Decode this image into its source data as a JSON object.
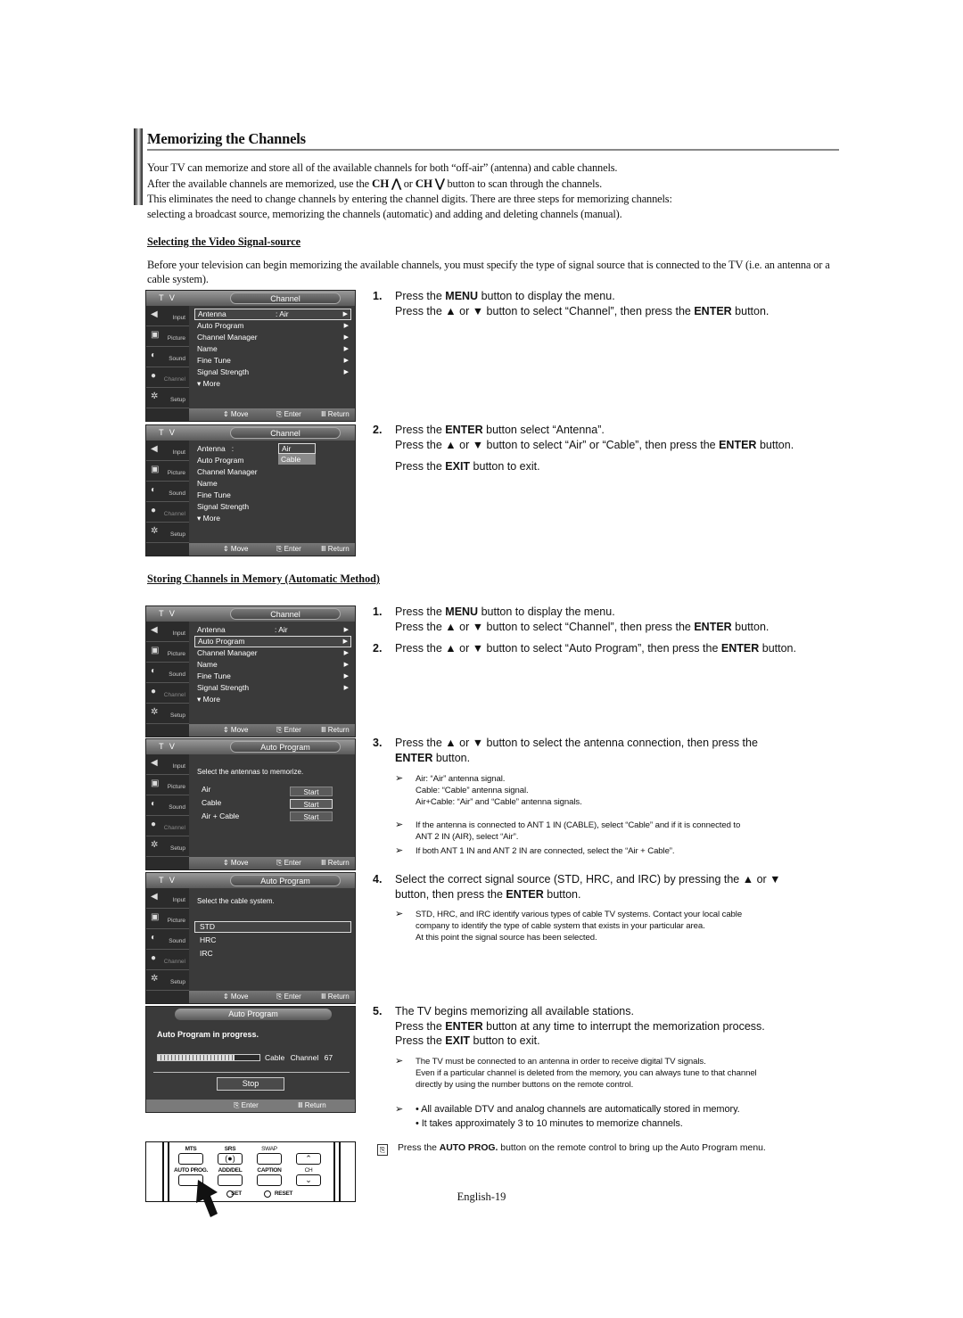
{
  "page": {
    "title": "Memorizing the Channels",
    "intro": {
      "line1": "Your TV can memorize and store all of the available channels for both “off-air” (antenna) and cable channels.",
      "line2_pre": "After the available channels are memorized, use the ",
      "ch_up": "CH ⋀",
      "line2_or": " or ",
      "ch_down": "CH ⋁",
      "line2_post": " button to scan through the channels.",
      "line3": "This eliminates the need to change channels by entering the channel digits. There are three steps for memorizing channels:",
      "line4": "selecting a broadcast source, memorizing the channels (automatic) and adding and deleting channels (manual)."
    },
    "footer": "English-19"
  },
  "section1": {
    "heading": "Selecting the Video Signal-source",
    "para": "Before your television can begin memorizing the available channels, you must specify the type of signal source that is connected to the TV (i.e. an antenna or a cable system).",
    "steps": [
      {
        "num": "1.",
        "l1_pre": "Press the ",
        "l1_b": "MENU",
        "l1_post": " button to display the menu.",
        "l2_pre": "Press the ▲ or ▼ button to select “Channel”, then press the ",
        "l2_b": "ENTER",
        "l2_post": " button."
      },
      {
        "num": "2.",
        "l1_pre": "Press the ",
        "l1_b": "ENTER",
        "l1_post": " button select “Antenna”.",
        "l2_pre": "Press the ▲ or ▼ button to select “Air” or “Cable”, then press the ",
        "l2_b": "ENTER",
        "l2_post": " button.",
        "l3_pre": "Press the ",
        "l3_b": "EXIT",
        "l3_post": " button to exit."
      }
    ]
  },
  "section2": {
    "heading": "Storing Channels in Memory (Automatic Method)",
    "steps": [
      {
        "num": "1.",
        "l1_pre": "Press the ",
        "l1_b": "MENU",
        "l1_post": " button to display the menu.",
        "l2_pre": "Press the ▲ or ▼ button to select “Channel”, then press the ",
        "l2_b": "ENTER",
        "l2_post": " button."
      },
      {
        "num": "2.",
        "l1_pre": "Press the ▲ or ▼ button to select “Auto Program”, then press the ",
        "l1_b": "ENTER",
        "l1_post": " button."
      },
      {
        "num": "3.",
        "l1_pre": "Press the ▲ or ▼ button to select the antenna connection, then press the",
        "l2_b": "ENTER",
        "l2_post": " button."
      },
      {
        "num": "4.",
        "l1_pre": "Select the correct signal source (STD, HRC, and IRC) by pressing the ▲ or ▼",
        "l2_pre": "button, then press the ",
        "l2_b": "ENTER",
        "l2_post": " button."
      },
      {
        "num": "5.",
        "l1_pre": "The TV begins memorizing all available stations.",
        "l2_pre": "Press the ",
        "l2_b": "ENTER",
        "l2_post": " button at any time to interrupt the memorization process.",
        "l3_pre": "Press the ",
        "l3_b": "EXIT",
        "l3_post": " button to exit."
      }
    ],
    "notes": {
      "step3_a": [
        "Air: “Air” antenna signal.",
        "Cable: “Cable” antenna signal.",
        "Air+Cable: “Air” and “Cable” antenna signals."
      ],
      "step3_b": [
        "If the antenna is connected to ANT 1 IN (CABLE), select “Cable” and if it is connected to",
        "ANT 2 IN (AIR), select “Air”."
      ],
      "step3_c": [
        "If both ANT 1 IN and ANT 2 IN are connected, select the “Air + Cable”."
      ],
      "step4": [
        "STD, HRC, and IRC identify various types of cable TV systems. Contact your local cable",
        "company to identify the type of cable system that exists in your particular area.",
        "At this point the signal source has been selected."
      ],
      "step5_a": [
        "The TV must be connected to an antenna in order to receive digital TV signals.",
        "Even if a particular channel is deleted from the memory, you can always tune to that channel",
        "directly by using the number buttons on the remote control."
      ],
      "step5_b": [
        "• All available DTV and analog channels are automatically stored in memory.",
        "• It takes approximately 3 to 10 minutes to memorize channels."
      ]
    },
    "tip": {
      "pre": "Press the ",
      "b": "AUTO PROG.",
      "post": " button on the remote control to bring up the Auto Program menu."
    }
  },
  "osd_common": {
    "tv_label": "T V",
    "side_items": [
      {
        "icon": "input-icon",
        "glyph": "◀",
        "label": "Input"
      },
      {
        "icon": "picture-icon",
        "glyph": "▣",
        "label": "Picture"
      },
      {
        "icon": "sound-icon",
        "glyph": "◐",
        "label": "Sound"
      },
      {
        "icon": "channel-icon",
        "glyph": "●",
        "label": "Channel"
      },
      {
        "icon": "setup-icon",
        "glyph": "✲",
        "label": "Setup"
      }
    ],
    "move": "⇕ Move",
    "enter": "⎘ Enter",
    "return": "Ⅲ Return",
    "arrow": "▶"
  },
  "osd_channel": {
    "title": "Channel",
    "items": [
      {
        "label": "Antenna",
        "value": ": Air"
      },
      {
        "label": "Auto Program",
        "value": ""
      },
      {
        "label": "Channel Manager",
        "value": ""
      },
      {
        "label": "Name",
        "value": ""
      },
      {
        "label": "Fine Tune",
        "value": ""
      },
      {
        "label": "Signal Strength",
        "value": ""
      }
    ],
    "more": "▾ More",
    "antenna_colon": "Antenna   :",
    "popup_options": [
      "Air",
      "Cable"
    ]
  },
  "osd_autoprog": {
    "title": "Auto Program",
    "prompt_antenna": "Select the antennas to memorize.",
    "antenna_options": [
      "Air",
      "Cable",
      "Air + Cable"
    ],
    "start": "Start",
    "prompt_cable": "Select the cable system.",
    "cable_options": [
      "STD",
      "HRC",
      "IRC"
    ]
  },
  "osd_progress": {
    "title": "Auto Program",
    "message": "Auto Program in progress.",
    "progress_percent": 75,
    "source": "Cable",
    "channel_label": "Channel",
    "channel_number": "67",
    "stop": "Stop",
    "enter": "⎘ Enter",
    "return": "Ⅲ Return"
  },
  "remote": {
    "labels": [
      "MTS",
      "SRS",
      "SWAP",
      "AUTO PROG.",
      "ADD/DEL",
      "CAPTION",
      "CH",
      "SET",
      "RESET"
    ],
    "srs_glyph": "(●)",
    "ch_up": "⌃",
    "ch_down": "⌄"
  }
}
